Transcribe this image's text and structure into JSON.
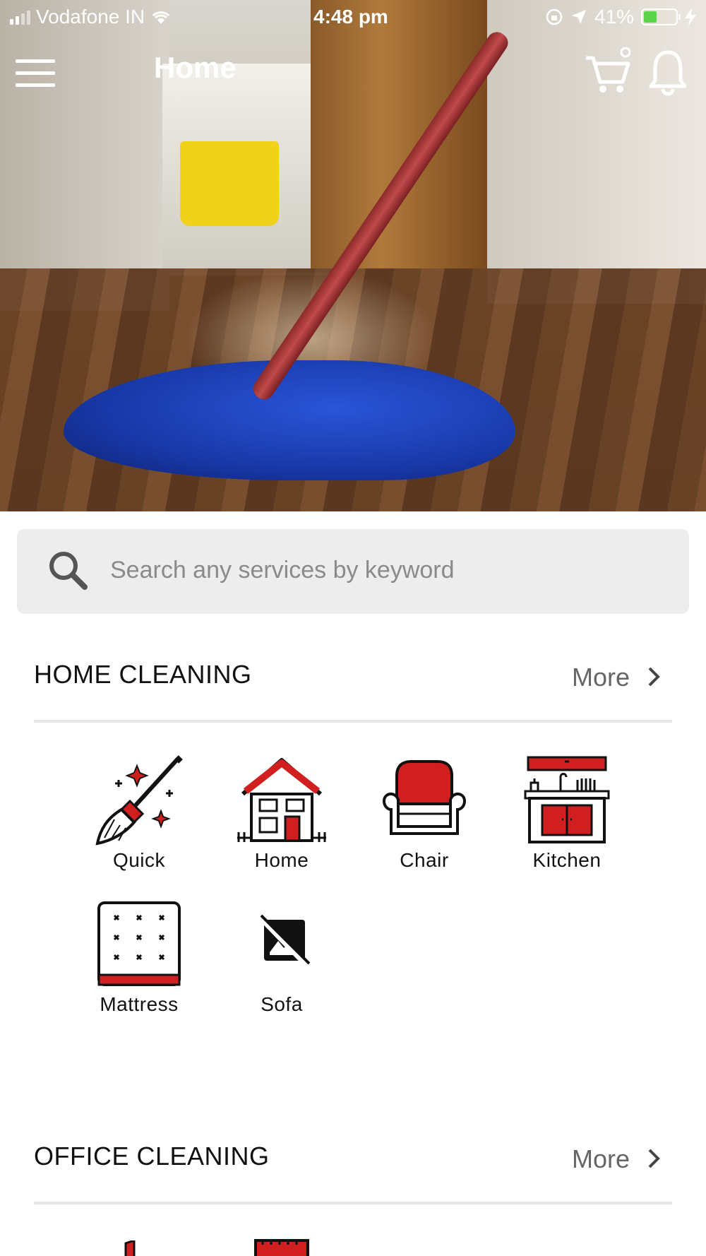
{
  "status_bar": {
    "carrier": "Vodafone IN",
    "time": "4:48 pm",
    "battery": "41%",
    "battery_fraction": 0.41
  },
  "nav": {
    "title": "Home",
    "icons": [
      "menu-icon",
      "cart-icon",
      "bell-icon"
    ]
  },
  "search": {
    "placeholder": "Search any services by keyword"
  },
  "sections": [
    {
      "title": "HOME CLEANING",
      "more": "More",
      "items": [
        {
          "label": "Quick",
          "icon": "broom-icon"
        },
        {
          "label": "Home",
          "icon": "house-icon"
        },
        {
          "label": "Chair",
          "icon": "armchair-icon"
        },
        {
          "label": "Kitchen",
          "icon": "kitchen-icon"
        },
        {
          "label": "Mattress",
          "icon": "mattress-icon"
        },
        {
          "label": "Sofa",
          "icon": "broken-image-icon"
        }
      ]
    },
    {
      "title": "OFFICE CLEANING",
      "more": "More"
    }
  ],
  "colors": {
    "accent": "#d11f1f",
    "search_bg": "#ededed",
    "divider": "#e6e6e6",
    "more_text": "#666666"
  }
}
